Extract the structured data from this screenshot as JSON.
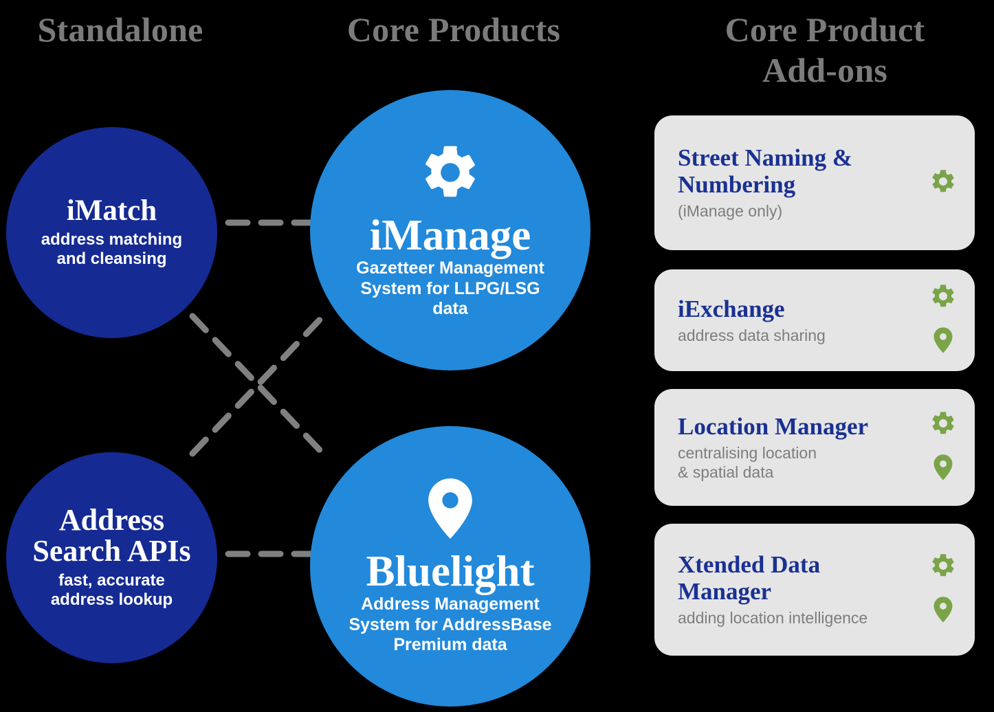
{
  "columns": {
    "standalone": "Standalone",
    "core_products": "Core Products",
    "core_product_addons": "Core Product\nAdd-ons"
  },
  "colors": {
    "navy": "#152A93",
    "light_blue": "#2389DA",
    "card_bg": "#E5E5E5",
    "addon_title": "#1A3193",
    "addon_sub": "#7D7D7D",
    "icon_green": "#7BA348",
    "heading_gray": "#7B7B7B",
    "connector_gray": "#808080",
    "background": "#000000"
  },
  "standalone_products": [
    {
      "name": "iMatch",
      "description": "address matching\nand cleansing"
    },
    {
      "name": "Address\nSearch\nAPIs",
      "description": "fast, accurate\naddress lookup"
    }
  ],
  "core_products": [
    {
      "name": "iManage",
      "description": "Gazetteer Management\nSystem for LLPG/LSG\ndata",
      "icon": "gear-icon"
    },
    {
      "name": "Bluelight",
      "description": "Address Management\nSystem for AddressBase\nPremium data",
      "icon": "location-pin-icon"
    }
  ],
  "addons": [
    {
      "title": "Street Naming &\nNumbering",
      "subtitle": "(iManage only)",
      "icons": [
        "gear-icon"
      ]
    },
    {
      "title": "iExchange",
      "subtitle": "address data sharing",
      "icons": [
        "gear-icon",
        "location-pin-icon"
      ]
    },
    {
      "title": "Location Manager",
      "subtitle": "centralising location\n& spatial data",
      "icons": [
        "gear-icon",
        "location-pin-icon"
      ]
    },
    {
      "title": "Xtended Data\nManager",
      "subtitle": "adding location intelligence",
      "icons": [
        "gear-icon",
        "location-pin-icon"
      ]
    }
  ],
  "connectors": [
    {
      "from": "iMatch",
      "to": "iManage",
      "style": "dashed"
    },
    {
      "from": "iMatch",
      "to": "Bluelight",
      "style": "dashed"
    },
    {
      "from": "Address Search APIs",
      "to": "iManage",
      "style": "dashed"
    },
    {
      "from": "Address Search APIs",
      "to": "Bluelight",
      "style": "dashed"
    }
  ]
}
